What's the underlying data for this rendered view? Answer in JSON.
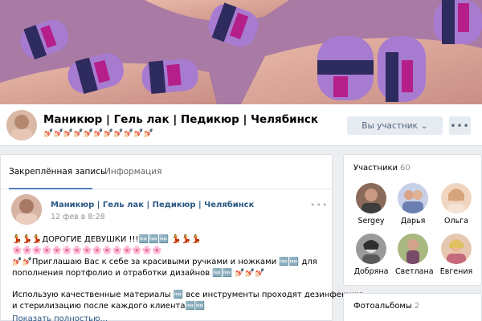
{
  "group": {
    "title": "Маникюр | Гель лак | Педикюр | Челябинск",
    "status": "💅🏻💅🏻💅🏻💅🏻💅🏻💅🏻💅🏻💅🏻💅🏻💅🏻💅🏻",
    "join_label": "Вы участник",
    "join_chevron": "⌄",
    "more_label": "•••"
  },
  "tabs": [
    {
      "label": "Закреплённая запись"
    },
    {
      "label": "Информация"
    }
  ],
  "post": {
    "author": "Маникюр | Гель лак | Педикюр | Челябинск",
    "date": "12 фев в 8:28",
    "menu": "•••",
    "lines": [
      "💃💃💃ДОРОГИЕ ДЕВУШКИ !!!🆓🆓🆓 💃💃💃",
      "🌸🌸🌸🌸🌸🌸🌸🌸🌸🌸🌸🌸🌸🌸🌸",
      "💅🏻💅🏻Приглашаю Вас к себе за красивыми ручками и ножками 🆓🆓 для",
      "пополнения портфолио и отработки дизайнов 🆓🆓 💅🏻💅🏻💅🏻",
      "Использую качественные материалы 🆓 все инструменты проходят дезинфекцию",
      "и стерилизацию после каждого клиента🆓🆓"
    ],
    "show_more": "Показать полностью..."
  },
  "members": {
    "title": "Участники",
    "count": "60",
    "items": [
      {
        "name": "Sergey",
        "color": "#8a6a5a"
      },
      {
        "name": "Дарья",
        "color": "#6a7fb0"
      },
      {
        "name": "Ольга",
        "color": "#d8a47e"
      },
      {
        "name": "Добряна",
        "color": "#5a5a5a"
      },
      {
        "name": "Светлана",
        "color": "#7a8a5a"
      },
      {
        "name": "Евгения",
        "color": "#c46a7a"
      }
    ]
  },
  "albums": {
    "title": "Фотоальбомы",
    "count": "2"
  },
  "colors": {
    "link": "#2a5885",
    "accent": "#5181b8",
    "background": "#edeef0",
    "nail_purple": "#7b3fa8",
    "nail_magenta": "#b51f8a",
    "nail_lilac": "#a77bd0",
    "nail_navy": "#2e2b5e"
  }
}
